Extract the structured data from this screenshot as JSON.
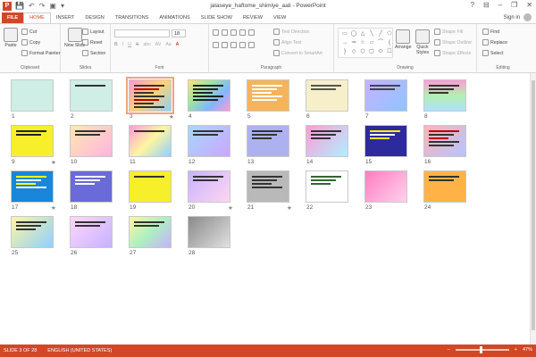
{
  "window": {
    "title": "jalaseye_haftome_shimiye_aali - PowerPoint",
    "app_icon": "P",
    "qat_save": "💾",
    "qat_undo": "↶",
    "qat_redo": "↷",
    "qat_present": "▣",
    "qat_more": "▾",
    "minimize": "–",
    "restore": "❐",
    "close": "✕",
    "help": "?",
    "ribbon_toggle": "⊟"
  },
  "tabs": [
    "FILE",
    "HOME",
    "INSERT",
    "DESIGN",
    "TRANSITIONS",
    "ANIMATIONS",
    "SLIDE SHOW",
    "REVIEW",
    "VIEW"
  ],
  "active_tab": "HOME",
  "signin": "Sign in",
  "ribbon": {
    "clipboard": {
      "label": "Clipboard",
      "paste": "Paste",
      "cut": "Cut",
      "copy": "Copy",
      "format_painter": "Format Painter"
    },
    "slides": {
      "label": "Slides",
      "new_slide": "New Slide",
      "layout": "Layout",
      "reset": "Reset",
      "section": "Section"
    },
    "font": {
      "label": "Font",
      "size": "18",
      "bold": "B",
      "italic": "I",
      "underline": "U",
      "strike": "S",
      "shadow": "abc",
      "spacing": "AV",
      "case": "Aa",
      "color": "A"
    },
    "paragraph": {
      "label": "Paragraph",
      "text_direction": "Text Direction",
      "align_text": "Align Text",
      "convert_smartart": "Convert to SmartArt"
    },
    "drawing": {
      "label": "Drawing",
      "arrange": "Arrange",
      "quick_styles": "Quick Styles",
      "shape_fill": "Shape Fill",
      "shape_outline": "Shape Outline",
      "shape_effects": "Shape Effects"
    },
    "editing": {
      "label": "Editing",
      "find": "Find",
      "replace": "Replace",
      "select": "Select"
    }
  },
  "slides": [
    {
      "num": "1",
      "star": ""
    },
    {
      "num": "2",
      "star": ""
    },
    {
      "num": "3",
      "star": "★"
    },
    {
      "num": "4",
      "star": ""
    },
    {
      "num": "5",
      "star": ""
    },
    {
      "num": "6",
      "star": ""
    },
    {
      "num": "7",
      "star": ""
    },
    {
      "num": "8",
      "star": ""
    },
    {
      "num": "9",
      "star": "★"
    },
    {
      "num": "10",
      "star": ""
    },
    {
      "num": "11",
      "star": ""
    },
    {
      "num": "12",
      "star": ""
    },
    {
      "num": "13",
      "star": ""
    },
    {
      "num": "14",
      "star": ""
    },
    {
      "num": "15",
      "star": ""
    },
    {
      "num": "16",
      "star": ""
    },
    {
      "num": "17",
      "star": "★"
    },
    {
      "num": "18",
      "star": ""
    },
    {
      "num": "19",
      "star": ""
    },
    {
      "num": "20",
      "star": "★"
    },
    {
      "num": "21",
      "star": "★"
    },
    {
      "num": "22",
      "star": ""
    },
    {
      "num": "23",
      "star": ""
    },
    {
      "num": "24",
      "star": ""
    },
    {
      "num": "25",
      "star": ""
    },
    {
      "num": "26",
      "star": ""
    },
    {
      "num": "27",
      "star": ""
    },
    {
      "num": "28",
      "star": ""
    }
  ],
  "selected_slide": "3",
  "status": {
    "slide_info": "SLIDE 3 OF 28",
    "language": "ENGLISH (UNITED STATES)",
    "zoom": "47%",
    "zoom_fraction": 0.47,
    "zoom_minus": "–",
    "zoom_plus": "+"
  },
  "colors": {
    "accent": "#d24726"
  }
}
